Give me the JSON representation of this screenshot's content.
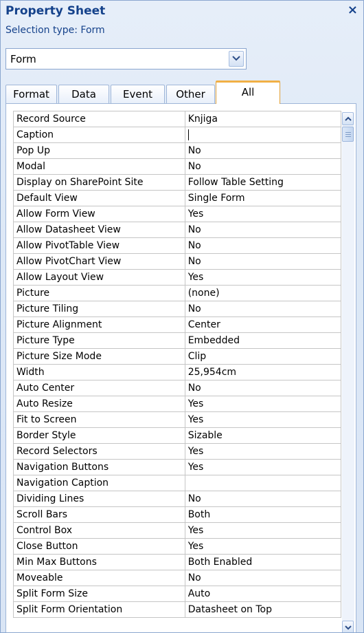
{
  "panel": {
    "title": "Property Sheet",
    "close_glyph": "×",
    "selection_type_label": "Selection type:  Form"
  },
  "selector": {
    "value": "Form",
    "icon": "chevron-down-icon"
  },
  "tabs": [
    {
      "label": "Format",
      "active": false
    },
    {
      "label": "Data",
      "active": false
    },
    {
      "label": "Event",
      "active": false
    },
    {
      "label": "Other",
      "active": false
    },
    {
      "label": "All",
      "active": true
    }
  ],
  "properties": [
    {
      "name": "Record Source",
      "value": "Knjiga"
    },
    {
      "name": "Caption",
      "value": ""
    },
    {
      "name": "Pop Up",
      "value": "No"
    },
    {
      "name": "Modal",
      "value": "No"
    },
    {
      "name": "Display on SharePoint Site",
      "value": "Follow Table Setting"
    },
    {
      "name": "Default View",
      "value": "Single Form"
    },
    {
      "name": "Allow Form View",
      "value": "Yes"
    },
    {
      "name": "Allow Datasheet View",
      "value": "No"
    },
    {
      "name": "Allow PivotTable View",
      "value": "No"
    },
    {
      "name": "Allow PivotChart View",
      "value": "No"
    },
    {
      "name": "Allow Layout View",
      "value": "Yes"
    },
    {
      "name": "Picture",
      "value": "(none)"
    },
    {
      "name": "Picture Tiling",
      "value": "No"
    },
    {
      "name": "Picture Alignment",
      "value": "Center"
    },
    {
      "name": "Picture Type",
      "value": "Embedded"
    },
    {
      "name": "Picture Size Mode",
      "value": "Clip"
    },
    {
      "name": "Width",
      "value": "25,954cm"
    },
    {
      "name": "Auto Center",
      "value": "No"
    },
    {
      "name": "Auto Resize",
      "value": "Yes"
    },
    {
      "name": "Fit to Screen",
      "value": "Yes"
    },
    {
      "name": "Border Style",
      "value": "Sizable"
    },
    {
      "name": "Record Selectors",
      "value": "Yes"
    },
    {
      "name": "Navigation Buttons",
      "value": "Yes"
    },
    {
      "name": "Navigation Caption",
      "value": ""
    },
    {
      "name": "Dividing Lines",
      "value": "No"
    },
    {
      "name": "Scroll Bars",
      "value": "Both"
    },
    {
      "name": "Control Box",
      "value": "Yes"
    },
    {
      "name": "Close Button",
      "value": "Yes"
    },
    {
      "name": "Min Max Buttons",
      "value": "Both Enabled"
    },
    {
      "name": "Moveable",
      "value": "No"
    },
    {
      "name": "Split Form Size",
      "value": "Auto"
    },
    {
      "name": "Split Form Orientation",
      "value": "Datasheet on Top"
    }
  ],
  "scrollbar": {
    "up_icon": "scroll-up-arrow-icon",
    "down_icon": "scroll-down-arrow-icon"
  }
}
